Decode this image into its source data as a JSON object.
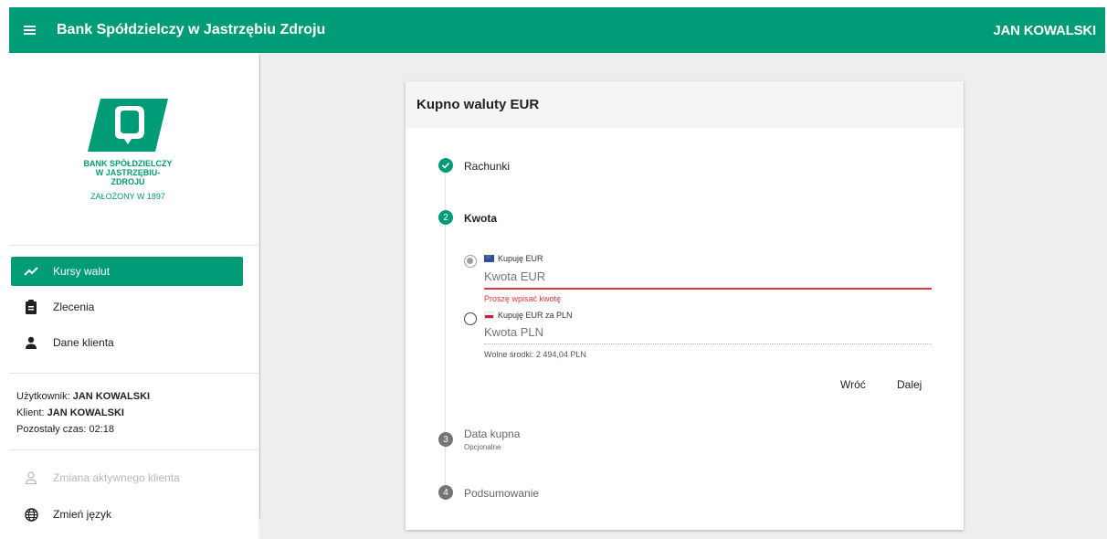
{
  "app": {
    "title": "Bank Spółdzielczy w Jastrzębiu Zdroju",
    "user": "JAN KOWALSKI"
  },
  "logo": {
    "line1": "BANK SPÓŁDZIELCZY",
    "line2": "W JASTRZĘBIU-ZDROJU",
    "founded": "ZAŁOŻONY W 1897"
  },
  "nav": {
    "items": [
      {
        "label": "Kursy walut",
        "icon": "trending-icon",
        "active": true
      },
      {
        "label": "Zlecenia",
        "icon": "clipboard-icon"
      },
      {
        "label": "Dane klienta",
        "icon": "person-icon"
      }
    ]
  },
  "session": {
    "user_label": "Użytkownik:",
    "user_value": "JAN KOWALSKI",
    "client_label": "Klient:",
    "client_value": "JAN KOWALSKI",
    "time_label": "Pozostały czas:",
    "time_value": "02:18"
  },
  "bottom_nav": [
    {
      "label": "Zmiana aktywnego klienta",
      "icon": "person-outline-icon",
      "disabled": true
    },
    {
      "label": "Zmień język",
      "icon": "globe-icon"
    }
  ],
  "card": {
    "title": "Kupno waluty EUR"
  },
  "steps": [
    {
      "label": "Rachunki",
      "state": "done"
    },
    {
      "number": "2",
      "label": "Kwota",
      "state": "active"
    },
    {
      "number": "3",
      "label": "Data kupna",
      "sub": "Opcjonalne",
      "state": "pending"
    },
    {
      "number": "4",
      "label": "Podsumowanie",
      "state": "pending"
    }
  ],
  "form": {
    "opt1_label": "Kupuję EUR",
    "opt1_placeholder": "Kwota EUR",
    "error": "Proszę wpisać kwotę",
    "opt2_label": "Kupuję EUR za PLN",
    "opt2_placeholder": "Kwota PLN",
    "available": "Wolne środki: 2 494,04 PLN",
    "back": "Wróć",
    "next": "Dalej"
  },
  "colors": {
    "brand": "#009b77",
    "error": "#e53935",
    "step_pending": "#757575"
  }
}
